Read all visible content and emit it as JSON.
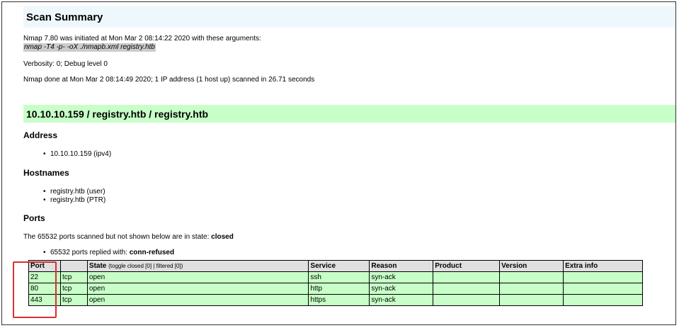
{
  "summary": {
    "title": "Scan Summary",
    "initiated": "Nmap 7.80 was initiated at Mon Mar 2 08:14:22 2020 with these arguments:",
    "command": "nmap -T4 -p- -oX ./nmapb.xml registry.htb",
    "verbosity": "Verbosity: 0; Debug level 0",
    "done": "Nmap done at Mon Mar 2 08:14:49 2020; 1 IP address (1 host up) scanned in 26.71 seconds"
  },
  "host": {
    "title": "10.10.10.159 / registry.htb / registry.htb",
    "address_heading": "Address",
    "addresses": [
      "10.10.10.159 (ipv4)"
    ],
    "hostnames_heading": "Hostnames",
    "hostnames": [
      "registry.htb (user)",
      "registry.htb (PTR)"
    ],
    "ports_heading": "Ports",
    "ports_state_prefix": "The 65532 ports scanned but not shown below are in state: ",
    "ports_state": "closed",
    "ports_replied_prefix": "65532 ports replied with: ",
    "ports_replied": "conn-refused"
  },
  "table": {
    "headers": {
      "port": "Port",
      "proto": "",
      "state": "State",
      "state_sub": "(toggle closed [0] | filtered [0])",
      "service": "Service",
      "reason": "Reason",
      "product": "Product",
      "version": "Version",
      "extra": "Extra info"
    },
    "rows": [
      {
        "port": "22",
        "proto": "tcp",
        "state": "open",
        "service": "ssh",
        "reason": "syn-ack",
        "product": "",
        "version": "",
        "extra": ""
      },
      {
        "port": "80",
        "proto": "tcp",
        "state": "open",
        "service": "http",
        "reason": "syn-ack",
        "product": "",
        "version": "",
        "extra": ""
      },
      {
        "port": "443",
        "proto": "tcp",
        "state": "open",
        "service": "https",
        "reason": "syn-ack",
        "product": "",
        "version": "",
        "extra": ""
      }
    ]
  },
  "colors": {
    "summary_bar": "#eef7fc",
    "host_bar": "#c8ffc8",
    "row_open": "#c8ffc8",
    "highlight": "#d93030"
  }
}
